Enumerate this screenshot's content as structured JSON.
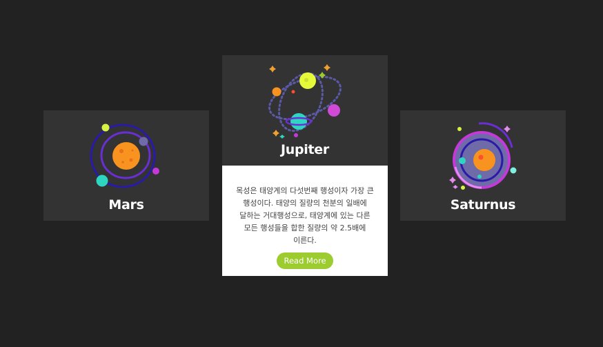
{
  "cards": [
    {
      "title": "Mars"
    },
    {
      "title": "Jupiter",
      "description": "목성은 태양계의 다섯번째 행성이자 가장 큰 행성이다. 태양의 질량의 천분의 일배에 달하는 거대행성으로, 태양계에 있는 다른 모든 행성들을 합한 질량의 약 2.5배에 이른다.",
      "read_more_label": "Read More"
    },
    {
      "title": "Saturnus"
    }
  ],
  "icons": [
    "mars-planet-illustration",
    "jupiter-planet-illustration",
    "saturnus-planet-illustration"
  ],
  "colors": {
    "page_background": "#222222",
    "card_background": "#333333",
    "content_background": "#ffffff",
    "button": "#9ccc2f",
    "title_text": "#ffffff",
    "body_text": "#444444"
  }
}
